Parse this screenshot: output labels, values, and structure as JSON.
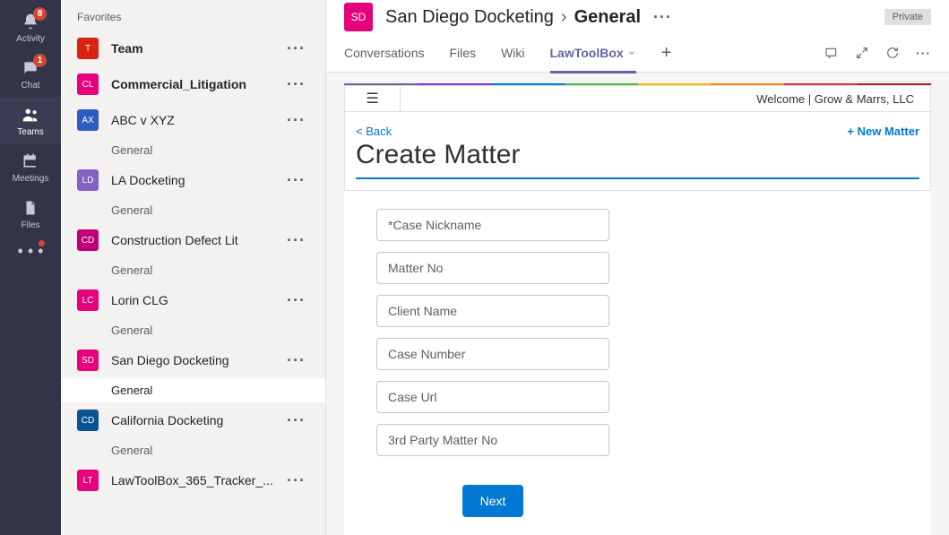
{
  "rail": {
    "items": [
      {
        "label": "Activity",
        "badge": "8"
      },
      {
        "label": "Chat",
        "badge": "1"
      },
      {
        "label": "Teams",
        "badge": ""
      },
      {
        "label": "Meetings",
        "badge": ""
      },
      {
        "label": "Files",
        "badge": ""
      }
    ]
  },
  "sidebar": {
    "favorites_label": "Favorites",
    "teams": [
      {
        "name": "Team",
        "initials": "T",
        "color": "bg-red",
        "bold": true,
        "channels": []
      },
      {
        "name": "Commercial_Litigation",
        "initials": "CL",
        "color": "bg-pink",
        "bold": true,
        "channels": []
      },
      {
        "name": "ABC v XYZ",
        "initials": "AX",
        "color": "bg-blue",
        "bold": false,
        "channels": [
          "General"
        ]
      },
      {
        "name": "LA Docketing",
        "initials": "LD",
        "color": "bg-purple",
        "bold": false,
        "channels": [
          "General"
        ]
      },
      {
        "name": "Construction Defect Lit",
        "initials": "CD",
        "color": "bg-magenta",
        "bold": false,
        "channels": [
          "General"
        ]
      },
      {
        "name": "Lorin CLG",
        "initials": "LC",
        "color": "bg-pink",
        "bold": false,
        "channels": [
          "General"
        ]
      },
      {
        "name": "San Diego Docketing",
        "initials": "SD",
        "color": "bg-pink",
        "bold": false,
        "channels": [
          "General"
        ],
        "selected_channel": 0
      },
      {
        "name": "California Docketing",
        "initials": "CD",
        "color": "bg-dblue",
        "bold": false,
        "channels": [
          "General"
        ]
      },
      {
        "name": "LawToolBox_365_Tracker_...",
        "initials": "LT",
        "color": "bg-pink",
        "bold": false,
        "channels": []
      }
    ]
  },
  "header": {
    "avatar_initials": "SD",
    "team": "San Diego Docketing",
    "channel": "General",
    "privacy": "Private"
  },
  "tabs": {
    "items": [
      "Conversations",
      "Files",
      "Wiki",
      "LawToolBox"
    ],
    "active_index": 3
  },
  "toolbar": {
    "welcome": "Welcome | Grow & Marrs, LLC"
  },
  "rainbow_colors": [
    "#6264a7",
    "#8a2be2",
    "#0078d4",
    "#46b950",
    "#ffb900",
    "#ff8c00",
    "#d13438",
    "#a4262c"
  ],
  "card": {
    "back": "< Back",
    "new": "+ New Matter",
    "title": "Create Matter"
  },
  "form": {
    "fields": [
      {
        "placeholder": "*Case Nickname"
      },
      {
        "placeholder": "Matter No"
      },
      {
        "placeholder": "Client Name"
      },
      {
        "placeholder": "Case Number"
      },
      {
        "placeholder": "Case Url"
      },
      {
        "placeholder": "3rd Party Matter No"
      }
    ],
    "next_label": "Next"
  }
}
